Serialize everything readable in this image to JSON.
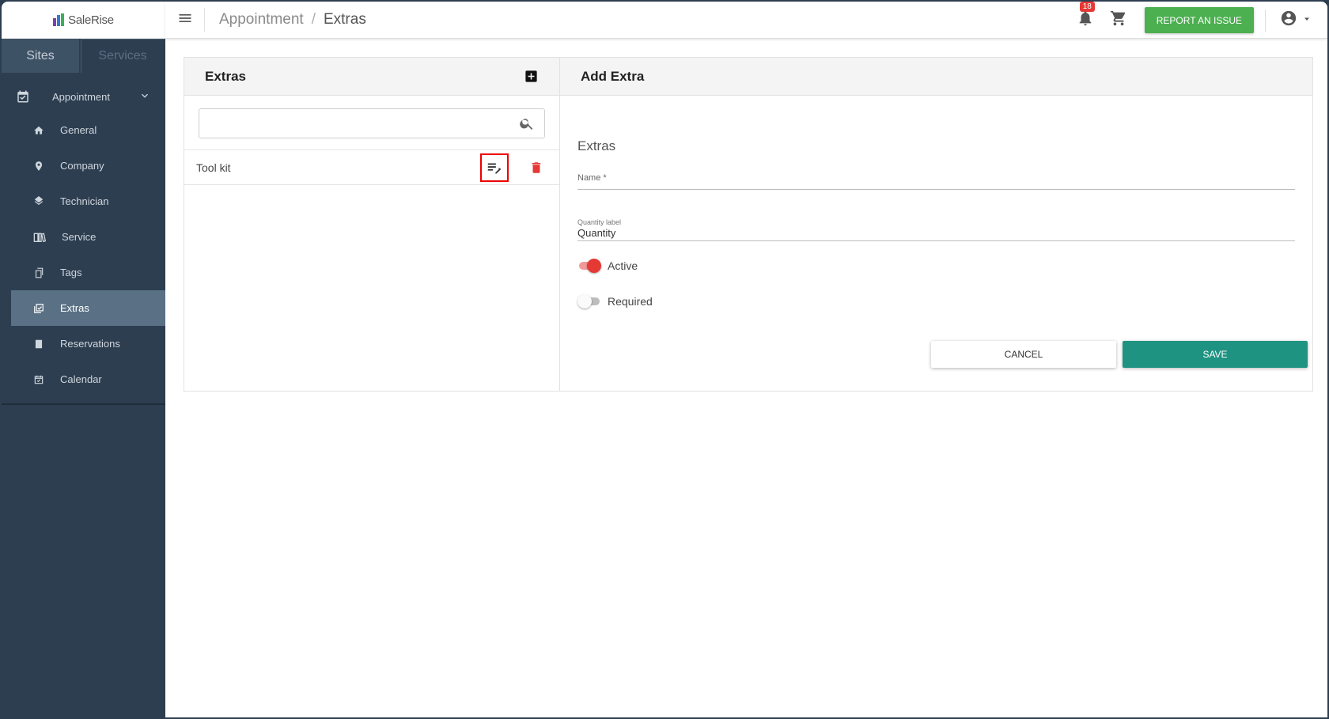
{
  "app": {
    "logo_text": "SaleRise"
  },
  "sidebar": {
    "tabs": [
      {
        "label": "Sites"
      },
      {
        "label": "Services"
      }
    ],
    "section": {
      "label": "Appointment"
    },
    "items": [
      {
        "label": "General",
        "icon": "home-icon"
      },
      {
        "label": "Company",
        "icon": "location-pin-icon"
      },
      {
        "label": "Technician",
        "icon": "layers-icon"
      },
      {
        "label": "Service",
        "icon": "book-icon"
      },
      {
        "label": "Tags",
        "icon": "tags-icon"
      },
      {
        "label": "Extras",
        "icon": "extras-icon",
        "active": true
      },
      {
        "label": "Reservations",
        "icon": "reservations-icon"
      },
      {
        "label": "Calendar",
        "icon": "calendar-icon"
      }
    ]
  },
  "header": {
    "breadcrumb": [
      "Appointment",
      "Extras"
    ],
    "separator": "/",
    "notifications_count": "18",
    "report_label": "REPORT AN ISSUE"
  },
  "list": {
    "title": "Extras",
    "search_placeholder": "",
    "rows": [
      {
        "name": "Tool kit"
      }
    ]
  },
  "form": {
    "title": "Add Extra",
    "section_title": "Extras",
    "name_label": "Name *",
    "quantity_label_caption": "Quantity label",
    "quantity_label_value": "Quantity",
    "active_label": "Active",
    "active_on": true,
    "required_label": "Required",
    "required_on": false,
    "cancel_label": "CANCEL",
    "save_label": "SAVE"
  },
  "colors": {
    "sidebar_bg": "#2d3e50",
    "sidebar_active": "#5a7185",
    "report_button": "#4caf50",
    "save_button": "#1f9382",
    "delete_icon": "#e53935",
    "toggle_on": "#e53935"
  }
}
